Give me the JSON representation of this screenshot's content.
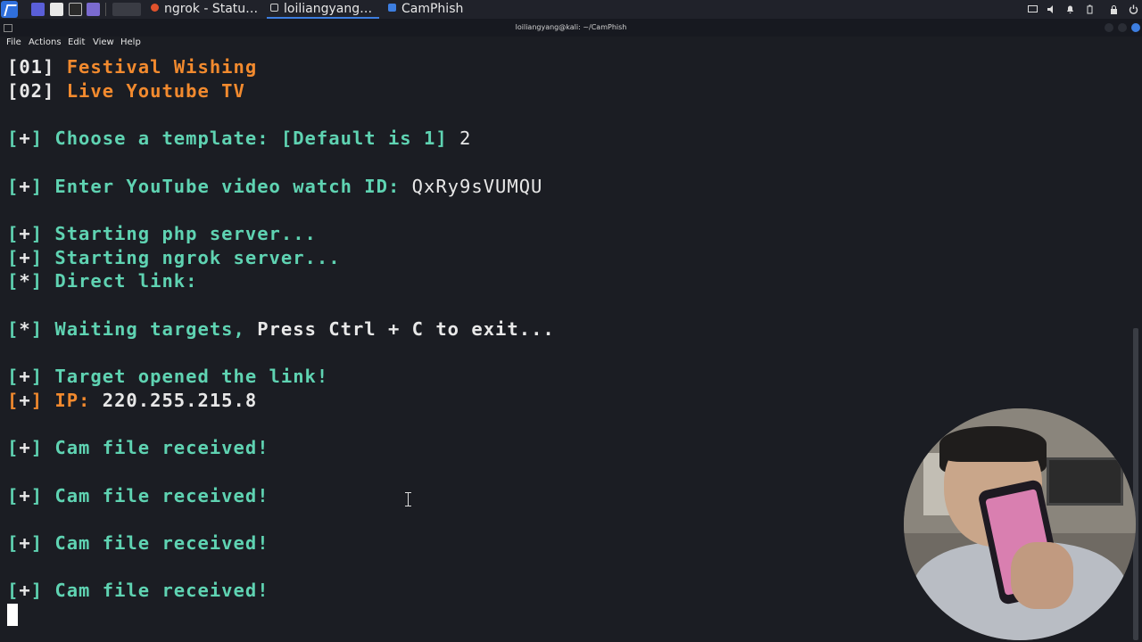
{
  "panel": {
    "tasks": [
      {
        "label": "ngrok - Statu…",
        "icon": "firefox-icon",
        "color": "#e0522c"
      },
      {
        "label": "loiliangyang…",
        "icon": "terminal-icon",
        "color": "#cfcfcf"
      },
      {
        "label": "CamPhish",
        "icon": "folder-icon",
        "color": "#3d7ee0"
      }
    ]
  },
  "window": {
    "title": "loiliangyang@kali: ~/CamPhish"
  },
  "menu": [
    "File",
    "Actions",
    "Edit",
    "View",
    "Help"
  ],
  "terminal": {
    "lines": [
      [
        {
          "t": "[",
          "c": "w"
        },
        {
          "t": "01",
          "c": "w"
        },
        {
          "t": "]",
          "c": "w"
        },
        {
          "t": " Festival Wishing",
          "c": "o"
        }
      ],
      [
        {
          "t": "[",
          "c": "w"
        },
        {
          "t": "02",
          "c": "w"
        },
        {
          "t": "]",
          "c": "w"
        },
        {
          "t": " Live Youtube TV",
          "c": "o"
        }
      ],
      [],
      [
        {
          "t": "[",
          "c": "c"
        },
        {
          "t": "+",
          "c": "w"
        },
        {
          "t": "]",
          "c": "c"
        },
        {
          "t": " Choose a template: [Default is 1] ",
          "c": "c"
        },
        {
          "t": "2",
          "c": "w",
          "normal": true
        }
      ],
      [],
      [
        {
          "t": "[",
          "c": "c"
        },
        {
          "t": "+",
          "c": "w"
        },
        {
          "t": "]",
          "c": "c"
        },
        {
          "t": " Enter YouTube video watch ID: ",
          "c": "c"
        },
        {
          "t": "QxRy9sVUMQU",
          "c": "w",
          "normal": true
        }
      ],
      [],
      [
        {
          "t": "[",
          "c": "c"
        },
        {
          "t": "+",
          "c": "w"
        },
        {
          "t": "]",
          "c": "c"
        },
        {
          "t": " Starting php server...",
          "c": "c"
        }
      ],
      [
        {
          "t": "[",
          "c": "c"
        },
        {
          "t": "+",
          "c": "w"
        },
        {
          "t": "]",
          "c": "c"
        },
        {
          "t": " Starting ngrok server...",
          "c": "c"
        }
      ],
      [
        {
          "t": "[",
          "c": "c"
        },
        {
          "t": "*",
          "c": "w"
        },
        {
          "t": "]",
          "c": "c"
        },
        {
          "t": " Direct link:",
          "c": "c"
        }
      ],
      [],
      [
        {
          "t": "[",
          "c": "c"
        },
        {
          "t": "*",
          "c": "w"
        },
        {
          "t": "]",
          "c": "c"
        },
        {
          "t": " Waiting targets, ",
          "c": "c"
        },
        {
          "t": "Press Ctrl + C to exit...",
          "c": "w"
        }
      ],
      [],
      [
        {
          "t": "[",
          "c": "c"
        },
        {
          "t": "+",
          "c": "w"
        },
        {
          "t": "]",
          "c": "c"
        },
        {
          "t": " Target opened the link!",
          "c": "c"
        }
      ],
      [
        {
          "t": "[",
          "c": "o"
        },
        {
          "t": "+",
          "c": "w"
        },
        {
          "t": "]",
          "c": "o"
        },
        {
          "t": " IP: ",
          "c": "o"
        },
        {
          "t": "220.255.215.8",
          "c": "w"
        }
      ],
      [],
      [
        {
          "t": "[",
          "c": "c"
        },
        {
          "t": "+",
          "c": "w"
        },
        {
          "t": "]",
          "c": "c"
        },
        {
          "t": " Cam file received!",
          "c": "c"
        }
      ],
      [],
      [
        {
          "t": "[",
          "c": "c"
        },
        {
          "t": "+",
          "c": "w"
        },
        {
          "t": "]",
          "c": "c"
        },
        {
          "t": " Cam file received!",
          "c": "c"
        }
      ],
      [],
      [
        {
          "t": "[",
          "c": "c"
        },
        {
          "t": "+",
          "c": "w"
        },
        {
          "t": "]",
          "c": "c"
        },
        {
          "t": " Cam file received!",
          "c": "c"
        }
      ],
      [],
      [
        {
          "t": "[",
          "c": "c"
        },
        {
          "t": "+",
          "c": "w"
        },
        {
          "t": "]",
          "c": "c"
        },
        {
          "t": " Cam file received!",
          "c": "c"
        }
      ]
    ]
  }
}
